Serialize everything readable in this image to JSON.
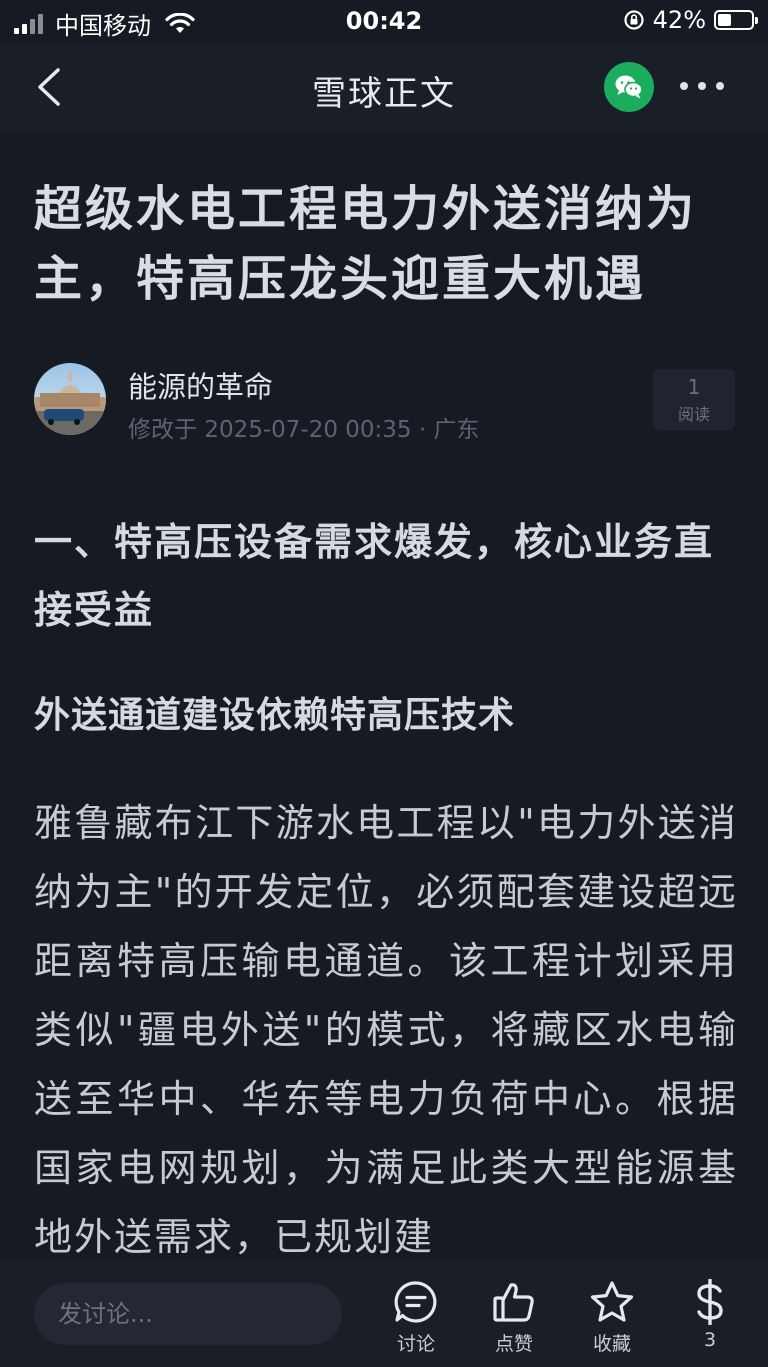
{
  "status_bar": {
    "carrier": "中国移动",
    "time": "00:42",
    "battery": "42%",
    "battery_level": 0.42
  },
  "nav": {
    "title": "雪球正文"
  },
  "article": {
    "title": "超级水电工程电力外送消纳为主，特高压龙头迎重大机遇",
    "author": "能源的革命",
    "meta": "修改于 2025-07-20 00:35 · 广东",
    "read_count": "1",
    "read_label": "阅读",
    "section_heading": "一、特高压设备需求爆发，核心业务直接受益",
    "subheading": "外送通道建设依赖特高压技术",
    "body": "雅鲁藏布江下游水电工程以\"电力外送消纳为主\"的开发定位，必须配套建设超远距离特高压输电通道。该工程计划采用类似\"疆电外送\"的模式，将藏区水电输送至华中、华东等电力负荷中心。根据国家电网规划，为满足此类大型能源基地外送需求，已规划建"
  },
  "bottom_bar": {
    "comment_placeholder": "发讨论...",
    "discuss_label": "讨论",
    "like_label": "点赞",
    "favorite_label": "收藏",
    "reward_count": "3"
  },
  "colors": {
    "background": "#161a23",
    "bar": "#1a1e27",
    "wechat_green": "#1aad5e"
  }
}
